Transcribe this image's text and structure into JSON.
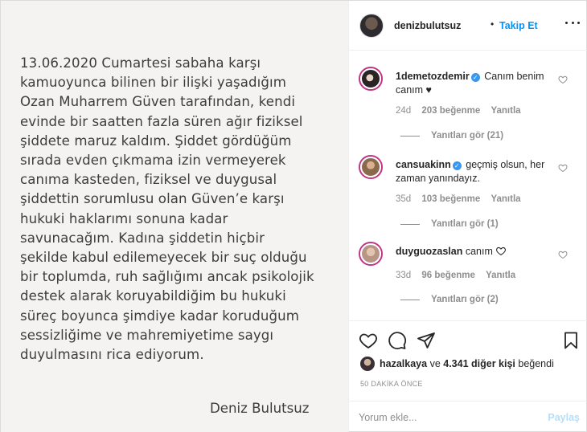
{
  "post": {
    "statement": "13.06.2020 Cumartesi sabaha karşı\nkamuoyunca bilinen bir ilişki yaşadığım\nOzan Muharrem Güven tarafından, kendi\nevinde bir saatten fazla süren ağır fiziksel\nşiddete maruz kaldım. Şiddet gördüğüm\nsırada evden çıkmama izin vermeyerek\ncanıma kasteden, fiziksel ve duygusal\nşiddettin sorumlusu olan Güven’e karşı\nhukuki haklarımı sonuna kadar\nsavunacağım. Kadına şiddetin hiçbir\nşekilde kabul edilemeyecek bir suç olduğu\nbir toplumda, ruh sağlığımı ancak psikolojik\ndestek alarak koruyabildiğim bu hukuki\nsüreç boyunca şimdiye kadar koruduğum\nsessizliğime ve mahremiyetime saygı\nduyulmasını rica ediyorum.",
    "signature": "Deniz Bulutsuz"
  },
  "header": {
    "username": "denizbulutsuz",
    "dot": "•",
    "follow_label": "Takip Et"
  },
  "comments": [
    {
      "username": "1demetozdemir",
      "text": "Canım benim canım ♥",
      "age": "24d",
      "likes": "203 beğenme",
      "reply": "Yanıtla",
      "view_replies": "Yanıtları gör (21)"
    },
    {
      "username": "cansuakinn",
      "text": "geçmiş olsun, her zaman yanındayız.",
      "age": "35d",
      "likes": "103 beğenme",
      "reply": "Yanıtla",
      "view_replies": "Yanıtları gör (1)"
    },
    {
      "username": "duyguozaslan",
      "text": "canım",
      "age": "33d",
      "likes": "96 beğenme",
      "reply": "Yanıtla",
      "view_replies": "Yanıtları gör (2)"
    }
  ],
  "likes": {
    "user": "hazalkaya",
    "connector": "ve",
    "others": "4.341 diğer kişi",
    "suffix": "beğendi"
  },
  "timestamp": "50 DAKİKA ÖNCE",
  "comment_box": {
    "placeholder": "Yorum ekle...",
    "post_label": "Paylaş"
  },
  "colors": {
    "accent": "#0095f6",
    "verified": "#3897f0",
    "muted": "#8e8e8e",
    "post_disabled": "#b2dffc"
  }
}
